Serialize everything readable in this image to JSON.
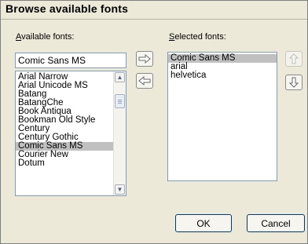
{
  "dialog": {
    "title": "Browse available fonts"
  },
  "available": {
    "label_first": "A",
    "label_rest": "vailable fonts:",
    "input_value": "Comic Sans MS",
    "items": [
      "Arial Narrow",
      "Arial Unicode MS",
      "Batang",
      "BatangChe",
      "Book Antiqua",
      "Bookman Old Style",
      "Century",
      "Century Gothic",
      "Comic Sans MS",
      "Courier New",
      "Dotum"
    ],
    "selected_item": "Comic Sans MS"
  },
  "selected": {
    "label_first": "S",
    "label_rest": "elected fonts:",
    "items": [
      "Comic Sans MS",
      "arial",
      "helvetica"
    ],
    "selected_item": "Comic Sans MS"
  },
  "icons": {
    "add": "arrow-right-icon",
    "remove": "arrow-left-icon",
    "move_up": "arrow-up-icon",
    "move_down": "arrow-down-icon"
  },
  "buttons": {
    "ok": "OK",
    "cancel": "Cancel"
  }
}
